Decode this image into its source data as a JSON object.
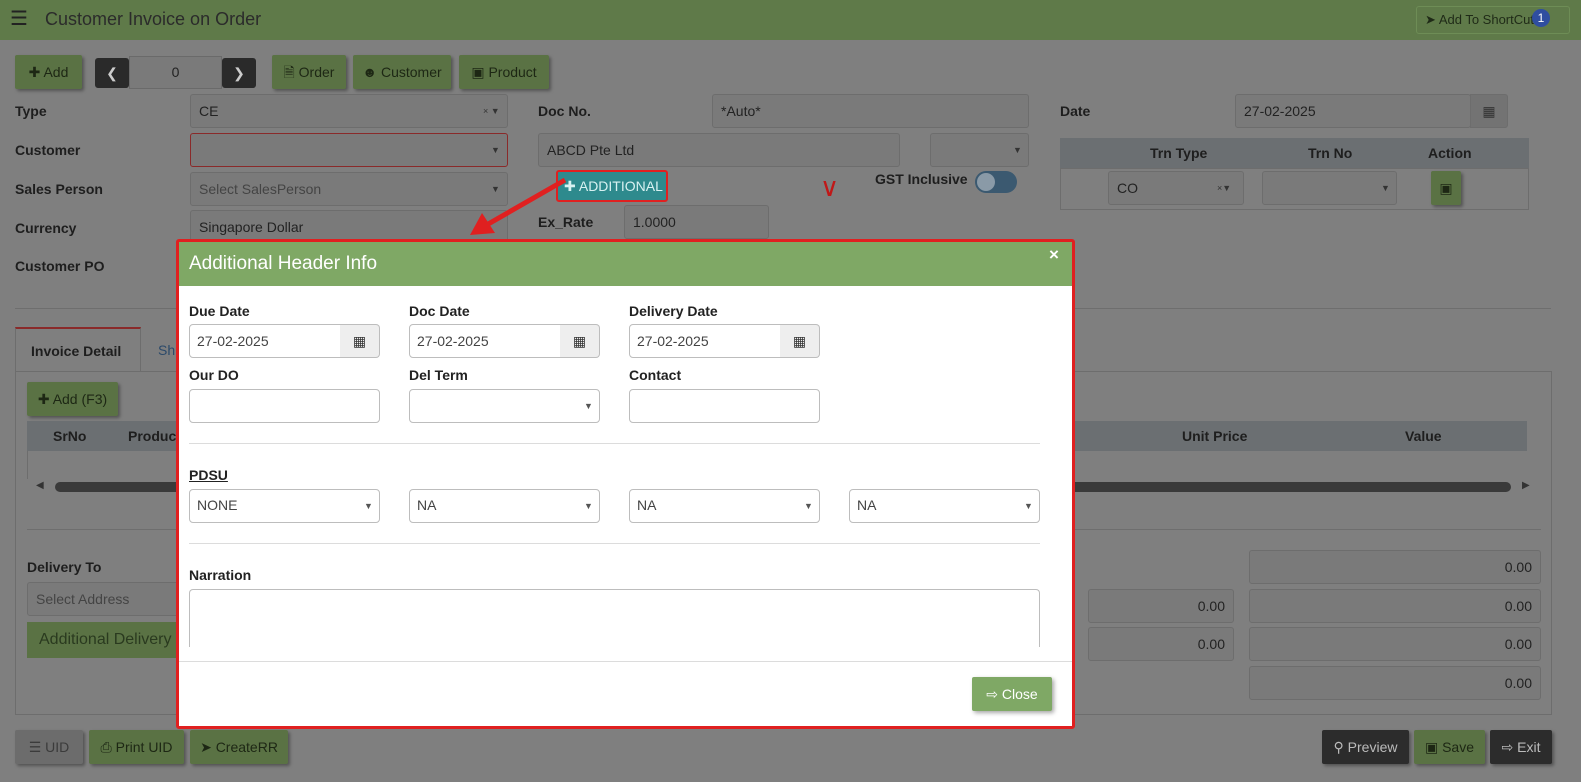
{
  "app": {
    "title": "Customer Invoice on Order",
    "shortcut_label": "Add To ShortCut",
    "shortcut_badge": "1"
  },
  "toolbar": {
    "add": "Add",
    "record_no": "0",
    "order": "Order",
    "customer": "Customer",
    "product": "Product"
  },
  "header": {
    "type_label": "Type",
    "type_value": "CE",
    "docno_label": "Doc No.",
    "docno_value": "*Auto*",
    "date_label": "Date",
    "date_value": "27-02-2025",
    "customer_label": "Customer",
    "customer_name": "ABCD Pte Ltd",
    "sales_label": "Sales Person",
    "sales_placeholder": "Select SalesPerson",
    "additional_btn": "ADDITIONAL",
    "gst_label": "GST Inclusive",
    "currency_label": "Currency",
    "currency_value": "Singapore Dollar",
    "exrate_label": "Ex_Rate",
    "exrate_value": "1.0000",
    "customer_po_label": "Customer PO"
  },
  "trn_table": {
    "headers": [
      "Trn Type",
      "Trn No",
      "Action"
    ],
    "type_value": "CO"
  },
  "tabs": {
    "invoice_detail": "Invoice Detail",
    "second": "Sh"
  },
  "detail": {
    "add_f3": "Add (F3)",
    "col_srno": "SrNo",
    "col_product": "Produc",
    "col_unit_price": "Unit Price",
    "col_value": "Value"
  },
  "bottom": {
    "delivery_to": "Delivery To",
    "select_address": "Select Address",
    "additional_delivery": "Additional Delivery I",
    "totals": [
      "0.00",
      "0.00",
      "0.00",
      "0.00",
      "0.00",
      "0.00"
    ]
  },
  "footer": {
    "uid": "UID",
    "print_uid": "Print UID",
    "create_rr": "CreateRR",
    "preview": "Preview",
    "save": "Save",
    "exit": "Exit"
  },
  "modal": {
    "title": "Additional Header Info",
    "close_x": "×",
    "due_date_label": "Due Date",
    "due_date_value": "27-02-2025",
    "doc_date_label": "Doc Date",
    "doc_date_value": "27-02-2025",
    "delivery_date_label": "Delivery Date",
    "delivery_date_value": "27-02-2025",
    "our_do_label": "Our DO",
    "del_term_label": "Del Term",
    "contact_label": "Contact",
    "pdsu_label": "PDSU",
    "pdsu_values": [
      "NONE",
      "NA",
      "NA",
      "NA"
    ],
    "narration_label": "Narration",
    "close_button": "Close"
  }
}
